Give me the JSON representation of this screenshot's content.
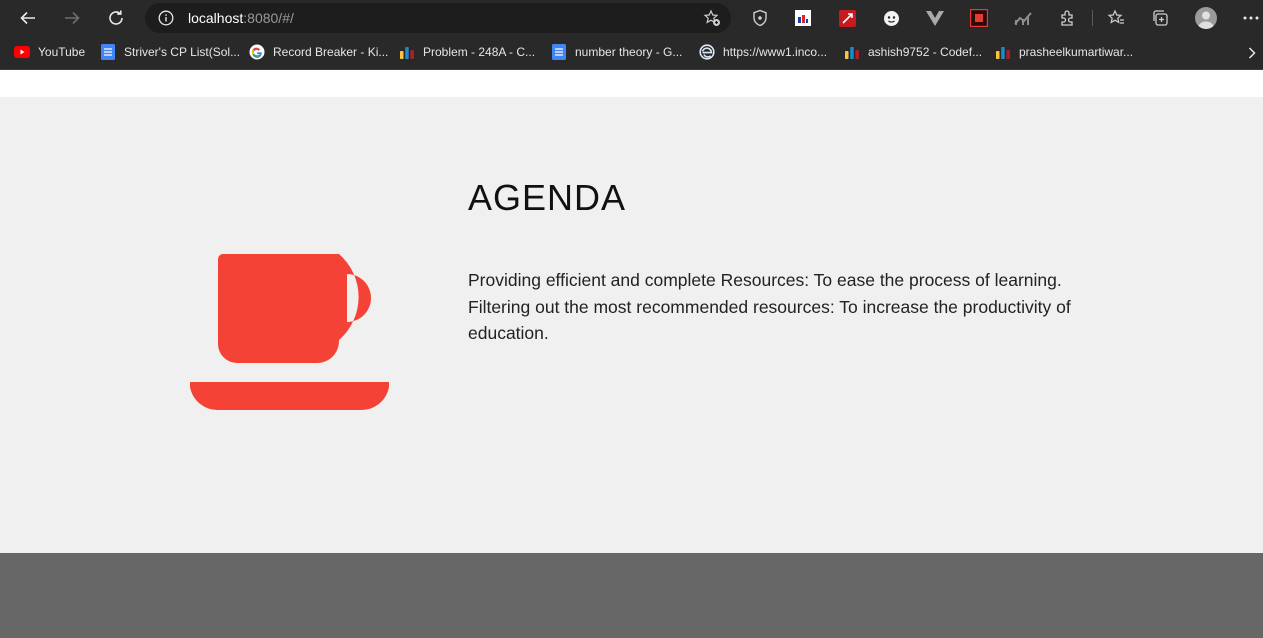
{
  "browser": {
    "url_host": "localhost",
    "url_rest": ":8080/#/",
    "bookmarks": [
      {
        "label": "YouTube",
        "icon": "youtube-icon"
      },
      {
        "label": "Striver's CP List(Sol...",
        "icon": "google-docs-icon"
      },
      {
        "label": "Record Breaker - Ki...",
        "icon": "google-icon"
      },
      {
        "label": "Problem - 248A - C...",
        "icon": "codeforces-icon"
      },
      {
        "label": "number theory - G...",
        "icon": "google-docs-icon"
      },
      {
        "label": "https://www1.inco...",
        "icon": "edge-icon"
      },
      {
        "label": "ashish9752 - Codef...",
        "icon": "codeforces-icon"
      },
      {
        "label": "prasheelkumartiwar...",
        "icon": "codeforces-icon"
      }
    ]
  },
  "agenda": {
    "title": "AGENDA",
    "text": "Providing efficient and complete Resources: To ease the process of learning. Filtering out the most recommended resources: To increase the productivity of education.",
    "icon": "coffee-cup-icon"
  },
  "colors": {
    "accent": "#f44336",
    "section_bg": "#f0f0f0",
    "footer_bg": "#676767",
    "toolbar_bg": "#292929"
  }
}
